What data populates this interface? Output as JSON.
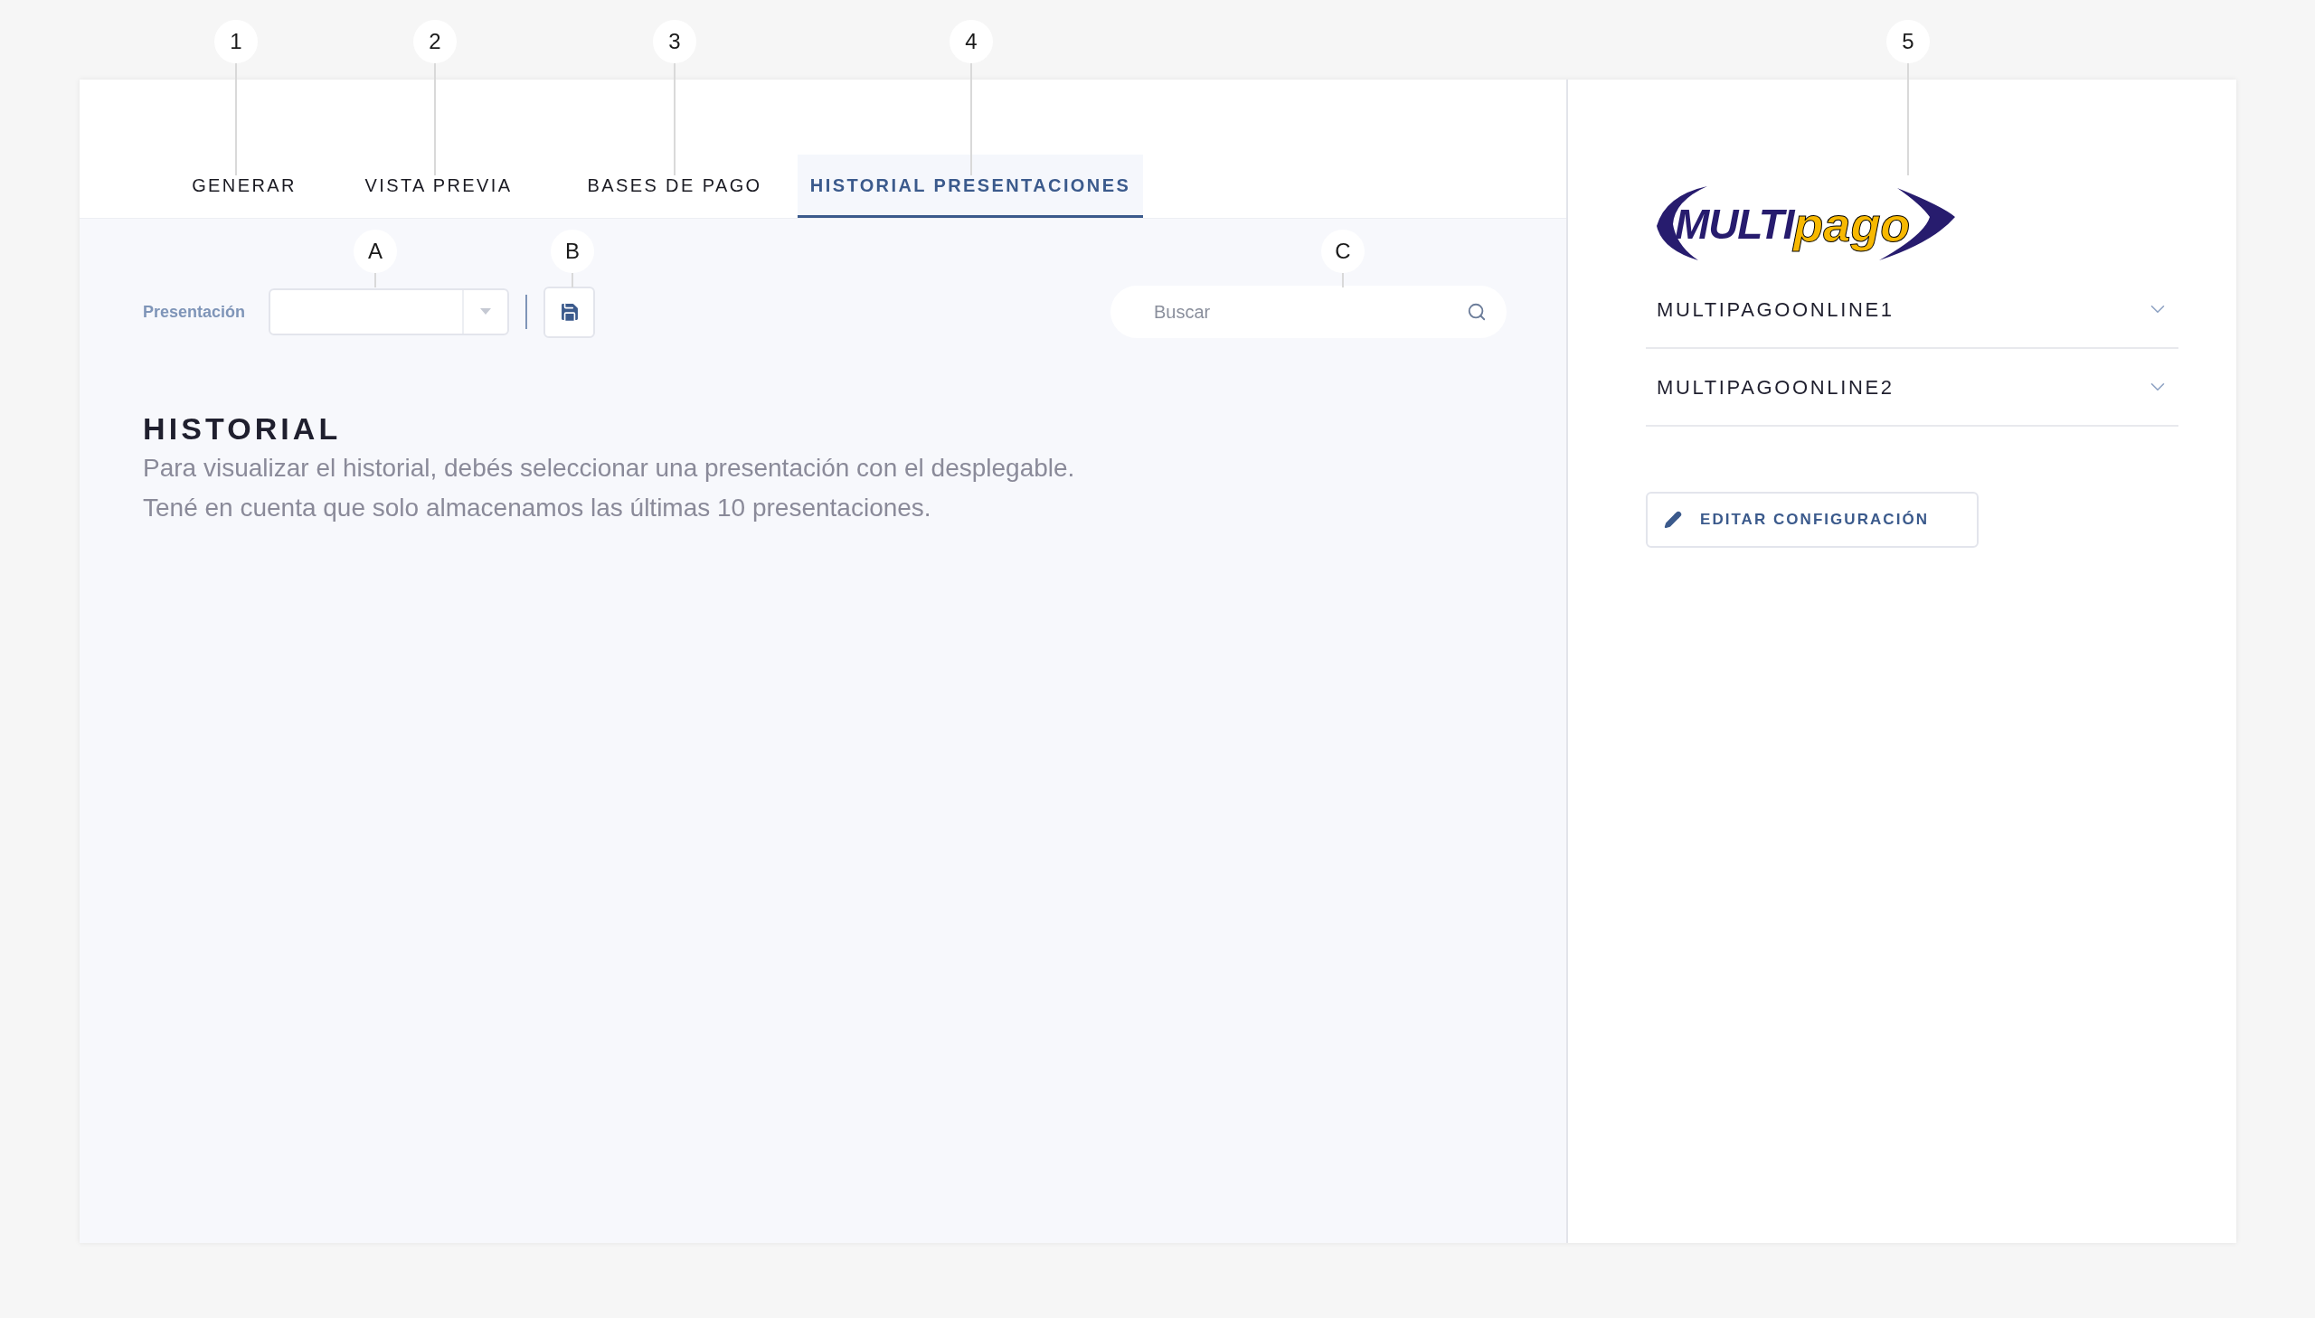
{
  "callouts": [
    {
      "label": "1"
    },
    {
      "label": "2"
    },
    {
      "label": "3"
    },
    {
      "label": "4"
    },
    {
      "label": "5"
    },
    {
      "label": "A"
    },
    {
      "label": "B"
    },
    {
      "label": "C"
    }
  ],
  "tabs": [
    {
      "label": "GENERAR",
      "selected": false
    },
    {
      "label": "VISTA PREVIA",
      "selected": false
    },
    {
      "label": "BASES DE PAGO",
      "selected": false
    },
    {
      "label": "HISTORIAL PRESENTACIONES",
      "selected": true
    }
  ],
  "toolbar": {
    "select_label": "Presentación",
    "search": {
      "placeholder": "Buscar"
    }
  },
  "history": {
    "title": "HISTORIAL",
    "lines": [
      "Para visualizar el historial, debés seleccionar una presentación con el desplegable.",
      "Tené en cuenta que solo almacenamos las últimas 10 presentaciones."
    ]
  },
  "sidebar": {
    "logo": {
      "part_1": "MULTI",
      "part_2": "pago"
    },
    "accounts": [
      {
        "name": "MULTIPAGOONLINE1",
        "expanded": false
      },
      {
        "name": "MULTIPAGOONLINE2",
        "expanded": false
      }
    ],
    "edit_button": "EDITAR CONFIGURACIÓN"
  }
}
